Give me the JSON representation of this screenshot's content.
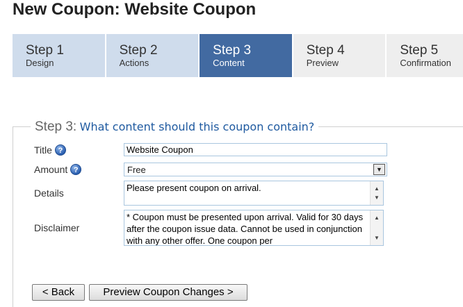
{
  "page": {
    "title": "New Coupon: Website Coupon"
  },
  "steps": [
    {
      "number": "Step 1",
      "label": "Design"
    },
    {
      "number": "Step 2",
      "label": "Actions"
    },
    {
      "number": "Step 3",
      "label": "Content",
      "active": true
    },
    {
      "number": "Step 4",
      "label": "Preview"
    },
    {
      "number": "Step 5",
      "label": "Confirmation"
    }
  ],
  "section": {
    "step_label": "Step 3:",
    "question": "What content should this coupon contain?"
  },
  "form": {
    "title_label": "Title",
    "title_value": "Website Coupon",
    "amount_label": "Amount",
    "amount_value": "Free",
    "details_label": "Details",
    "details_value": "Please present coupon on arrival.",
    "disclaimer_label": "Disclaimer",
    "disclaimer_value": "* Coupon must be presented upon arrival. Valid for 30 days after the coupon issue data. Cannot be used in conjunction with any other offer. One coupon per"
  },
  "buttons": {
    "back": "< Back",
    "preview": "Preview Coupon Changes >"
  },
  "icons": {
    "help": "help-question-icon",
    "dropdown": "dropdown-arrow-icon"
  },
  "colors": {
    "active_step": "#426aa1",
    "inactive_step_done": "#cfdcec",
    "inactive_step_pending": "#eeeeee",
    "question_text": "#1f5aa0"
  }
}
